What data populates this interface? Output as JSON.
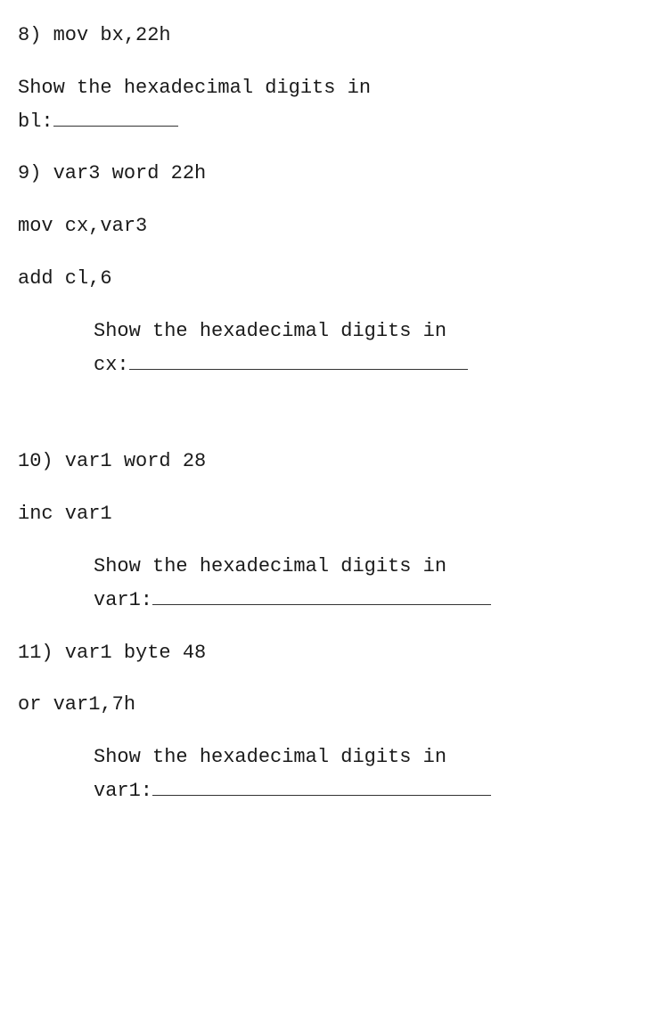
{
  "q8": {
    "code1": "8) mov bx,22h",
    "prompt1": "Show the hexadecimal digits in",
    "prompt2": "bl:"
  },
  "q9": {
    "code1": "9) var3 word 22h",
    "code2": "mov cx,var3",
    "code3": "add cl,6",
    "prompt1": "Show the hexadecimal digits in",
    "prompt2": "cx:"
  },
  "q10": {
    "code1": "10) var1 word 28",
    "code2": "inc var1",
    "prompt1": "Show the hexadecimal digits in",
    "prompt2": "var1:"
  },
  "q11": {
    "code1": "11) var1 byte 48",
    "code2": "or var1,7h",
    "prompt1": "Show the hexadecimal digits in",
    "prompt2": "var1:"
  }
}
